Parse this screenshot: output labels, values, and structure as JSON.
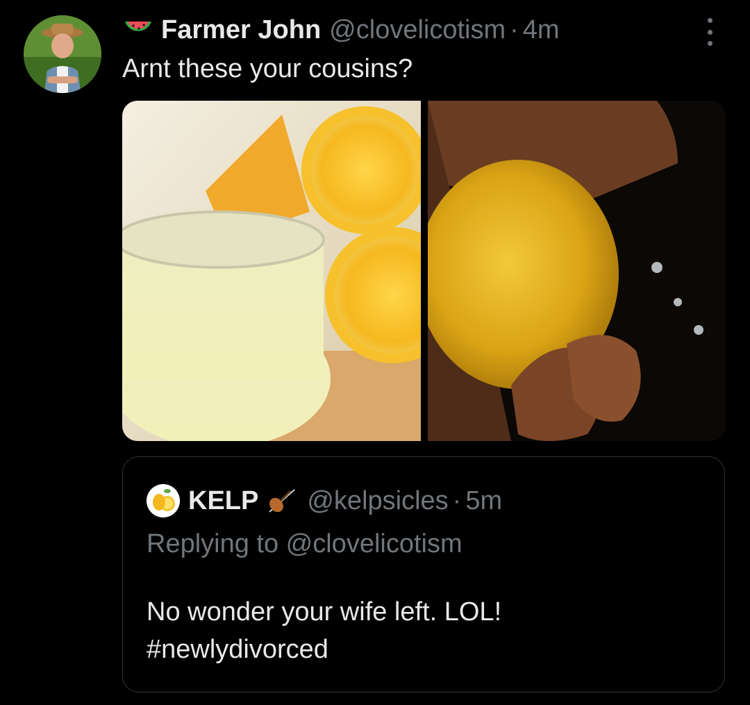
{
  "post": {
    "name_emoji_icon": "watermelon-icon",
    "display_name": "Farmer John",
    "handle": "@clovelicotism",
    "separator": "·",
    "time": "4m",
    "text": "Arnt these your cousins?",
    "media": [
      {
        "icon": "lemon-juice-photo"
      },
      {
        "icon": "squeezed-lemon-photo"
      }
    ]
  },
  "quote": {
    "display_name": "KELP",
    "name_emoji_icon": "violin-icon",
    "handle": "@kelpsicles",
    "separator": "·",
    "time": "5m",
    "replying_to": "Replying to @clovelicotism",
    "body_line1": "No wonder your wife left. LOL!",
    "body_line2": "#newlydivorced"
  },
  "colors": {
    "background": "#000000",
    "primary_text": "#e7e9ea",
    "secondary_text": "#71767b",
    "border": "#2f3336"
  }
}
